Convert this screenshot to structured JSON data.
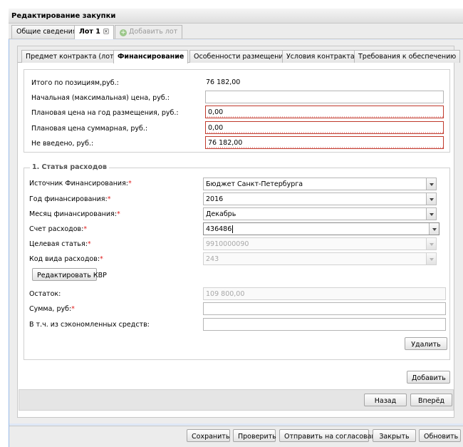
{
  "window": {
    "title": "Редактирование закупки"
  },
  "top_tabs": [
    {
      "label": "Общие сведения"
    },
    {
      "label": "Лот 1"
    },
    {
      "label": "Добавить лот"
    }
  ],
  "sub_tabs": [
    {
      "label": "Предмет контракта (лота)"
    },
    {
      "label": "Финансирование"
    },
    {
      "label": "Особенности размещения"
    },
    {
      "label": "Условия контракта"
    },
    {
      "label": "Требования к обеспечению"
    }
  ],
  "summary": {
    "total_label": "Итого по позициям,руб.:",
    "total_value": "76 182,00",
    "initial_price_label": "Начальная (максимальная) цена, руб.:",
    "initial_price_value": "",
    "planned_year_label": "Плановая цена на год размещения, руб.:",
    "planned_year_value": "0,00",
    "planned_total_label": "Плановая цена суммарная, руб.:",
    "planned_total_value": "0,00",
    "not_entered_label": "Не введено, руб.:",
    "not_entered_value": "76 182,00"
  },
  "expense": {
    "legend": "1. Статья расходов",
    "source_label": "Источник Финансирования:",
    "source_value": "Бюджет Санкт-Петербурга",
    "year_label": "Год финансирования:",
    "year_value": "2016",
    "month_label": "Месяц финансирования:",
    "month_value": "Декабрь",
    "account_label": "Счет расходов:",
    "account_value": "436486",
    "target_label": "Целевая статья:",
    "target_value": "9910000090",
    "kind_label": "Код вида расходов:",
    "kind_value": "243",
    "edit_kvr_label": "Редактировать КВР",
    "remainder_label": "Остаток:",
    "remainder_value": "109 800,00",
    "sum_label": "Сумма, руб:",
    "sum_value": "",
    "saved_label": "В т.ч. из сэкономленных средств:",
    "saved_value": "",
    "delete_label": "Удалить",
    "required_mark": "*"
  },
  "add_label": "Добавить",
  "nav": {
    "back_label": "Назад",
    "forward_label": "Вперёд"
  },
  "bottom": {
    "save_label": "Сохранить",
    "check_label": "Проверить",
    "send_label": "Отправить на согласование",
    "close_label": "Закрыть",
    "refresh_label": "Обновить"
  },
  "icons": {
    "add_lot": "plus-circle-icon",
    "close_tab": "close-icon",
    "dropdown": "chevron-down-icon"
  }
}
